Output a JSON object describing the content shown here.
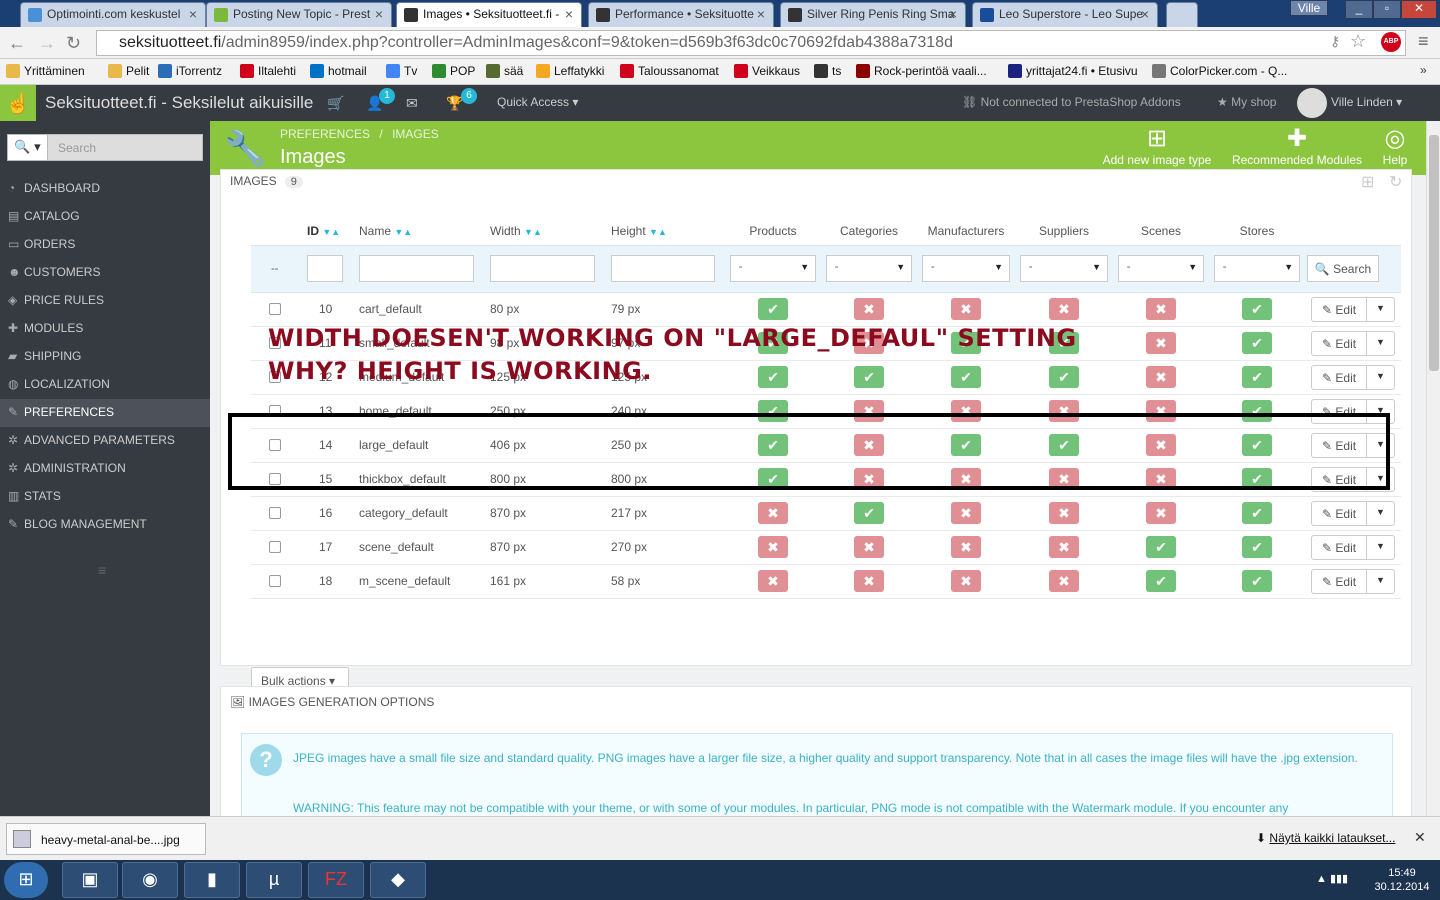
{
  "browser": {
    "tabs": [
      {
        "label": "Optimointi.com keskustel",
        "active": false,
        "icon_color": "#4a90d9"
      },
      {
        "label": "Posting New Topic - Prest",
        "active": false,
        "icon_color": "#7bb93c"
      },
      {
        "label": "Images • Seksituotteet.fi -",
        "active": true,
        "icon_color": "#333333"
      },
      {
        "label": "Performance • Seksituotte",
        "active": false,
        "icon_color": "#333333"
      },
      {
        "label": "Silver Ring Penis Ring Sma",
        "active": false,
        "icon_color": "#333333"
      },
      {
        "label": "Leo Superstore - Leo Supe",
        "active": false,
        "icon_color": "#1a4d99"
      }
    ],
    "user_badge": "Ville",
    "url_host": "seksituotteet.fi",
    "url_path": "/admin8959/index.php?controller=AdminImages&conf=9&token=d569b3f63dc0c70692fdab4388a7318d",
    "abp_label": "ABP",
    "bookmarks": [
      {
        "label": "Yrittäminen",
        "color": "#e8b84a"
      },
      {
        "label": "Pelit",
        "color": "#e8b84a"
      },
      {
        "label": "iTorrentz",
        "color": "#2a6fb5"
      },
      {
        "label": "Iltalehti",
        "color": "#d0021b"
      },
      {
        "label": "hotmail",
        "color": "#0072c6"
      },
      {
        "label": "Tv",
        "color": "#4285f4"
      },
      {
        "label": "POP",
        "color": "#2e8b2e"
      },
      {
        "label": "sää",
        "color": "#556b2f"
      },
      {
        "label": "Leffatykki",
        "color": "#f5a623"
      },
      {
        "label": "Taloussanomat",
        "color": "#d0021b"
      },
      {
        "label": "Veikkaus",
        "color": "#d0021b"
      },
      {
        "label": "ts",
        "color": "#333333"
      },
      {
        "label": "Rock-perintöä vaali...",
        "color": "#8b0000"
      },
      {
        "label": "yrittajat24.fi • Etusivu",
        "color": "#1a237e"
      },
      {
        "label": "ColorPicker.com - Q...",
        "color": "#777777"
      }
    ]
  },
  "header": {
    "shop_name": "Seksituotteet.fi - Seksilelut aikuisille",
    "badge_customers": "1",
    "badge_trophy": "6",
    "quick_access": "Quick Access",
    "not_connected": "Not connected to PrestaShop Addons",
    "my_shop": "My shop",
    "user": "Ville Linden"
  },
  "sidebar": {
    "search_placeholder": "Search",
    "items": [
      {
        "label": "DASHBOARD",
        "icon": "dashboard-icon",
        "glyph": "◔",
        "active": false
      },
      {
        "label": "CATALOG",
        "icon": "catalog-icon",
        "glyph": "▤",
        "active": false
      },
      {
        "label": "ORDERS",
        "icon": "orders-icon",
        "glyph": "▭",
        "active": false
      },
      {
        "label": "CUSTOMERS",
        "icon": "customers-icon",
        "glyph": "☻",
        "active": false
      },
      {
        "label": "PRICE RULES",
        "icon": "price-tag-icon",
        "glyph": "◈",
        "active": false
      },
      {
        "label": "MODULES",
        "icon": "puzzle-icon",
        "glyph": "✚",
        "active": false
      },
      {
        "label": "SHIPPING",
        "icon": "truck-icon",
        "glyph": "▰",
        "active": false
      },
      {
        "label": "LOCALIZATION",
        "icon": "globe-icon",
        "glyph": "◍",
        "active": false
      },
      {
        "label": "PREFERENCES",
        "icon": "wrench-icon",
        "glyph": "✎",
        "active": true
      },
      {
        "label": "ADVANCED PARAMETERS",
        "icon": "cogs-icon",
        "glyph": "✲",
        "active": false
      },
      {
        "label": "ADMINISTRATION",
        "icon": "cog-icon",
        "glyph": "✲",
        "active": false
      },
      {
        "label": "STATS",
        "icon": "bar-chart-icon",
        "glyph": "▥",
        "active": false
      },
      {
        "label": "BLOG MANAGEMENT",
        "icon": "pencil-icon",
        "glyph": "✎",
        "active": false
      }
    ]
  },
  "page": {
    "breadcrumb_1": "PREFERENCES",
    "breadcrumb_sep": "/",
    "breadcrumb_2": "IMAGES",
    "title": "Images",
    "btn_add": "Add new image type",
    "btn_modules": "Recommended Modules",
    "btn_help": "Help"
  },
  "images_panel": {
    "heading": "IMAGES",
    "count": "9",
    "columns": {
      "id": "ID",
      "name": "Name",
      "width": "Width",
      "height": "Height",
      "products": "Products",
      "categories": "Categories",
      "manufacturers": "Manufacturers",
      "suppliers": "Suppliers",
      "scenes": "Scenes",
      "stores": "Stores"
    },
    "filter_dash": "--",
    "select_value": "-",
    "search_label": "Search",
    "edit_label": "Edit",
    "bulk_label": "Bulk actions",
    "rows": [
      {
        "id": "10",
        "name": "cart_default",
        "width": "80 px",
        "height": "79 px",
        "flags": [
          true,
          false,
          false,
          false,
          false,
          true
        ]
      },
      {
        "id": "11",
        "name": "small_default",
        "width": "98 px",
        "height": "97 px",
        "flags": [
          true,
          false,
          true,
          true,
          false,
          true
        ]
      },
      {
        "id": "12",
        "name": "medium_default",
        "width": "125 px",
        "height": "125 px",
        "flags": [
          true,
          true,
          true,
          true,
          false,
          true
        ]
      },
      {
        "id": "13",
        "name": "home_default",
        "width": "250 px",
        "height": "240 px",
        "flags": [
          true,
          false,
          false,
          false,
          false,
          true
        ]
      },
      {
        "id": "14",
        "name": "large_default",
        "width": "406 px",
        "height": "250 px",
        "flags": [
          true,
          false,
          true,
          true,
          false,
          true
        ]
      },
      {
        "id": "15",
        "name": "thickbox_default",
        "width": "800 px",
        "height": "800 px",
        "flags": [
          true,
          false,
          false,
          false,
          false,
          true
        ]
      },
      {
        "id": "16",
        "name": "category_default",
        "width": "870 px",
        "height": "217 px",
        "flags": [
          false,
          true,
          false,
          false,
          false,
          true
        ]
      },
      {
        "id": "17",
        "name": "scene_default",
        "width": "870 px",
        "height": "270 px",
        "flags": [
          false,
          false,
          false,
          false,
          true,
          true
        ]
      },
      {
        "id": "18",
        "name": "m_scene_default",
        "width": "161 px",
        "height": "58 px",
        "flags": [
          false,
          false,
          false,
          false,
          true,
          true
        ]
      }
    ]
  },
  "generation_panel": {
    "heading": "IMAGES GENERATION OPTIONS",
    "info_text": "JPEG images have a small file size and standard quality. PNG images have a larger file size, a higher quality and support transparency. Note that in all cases the image files will have the .jpg extension.",
    "warning_text": "WARNING: This feature may not be compatible with your theme, or with some of your modules. In particular, PNG mode is not compatible with the Watermark module. If you encounter any"
  },
  "annotation": {
    "line1": "WIDTH DOESEN'T WORKING ON \"LARGE_DEFAUL\"  SETTING",
    "line2": "WHY? HEIGHT IS WORKING."
  },
  "downloads": {
    "file": "heavy-metal-anal-be....jpg",
    "show_all": "Näytä kaikki lataukset..."
  },
  "taskbar": {
    "time": "15:49",
    "date": "30.12.2014"
  }
}
